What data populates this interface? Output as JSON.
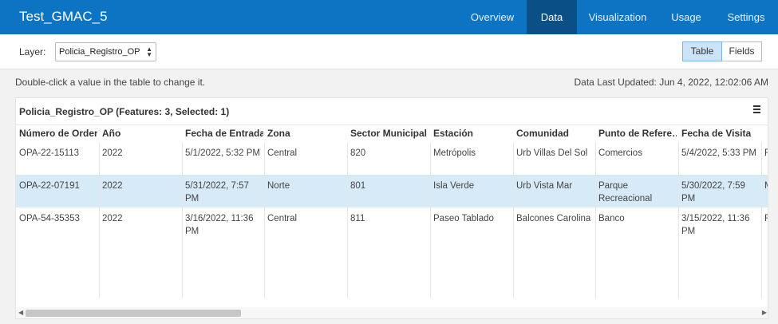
{
  "app": {
    "title": "Test_GMAC_5"
  },
  "nav": {
    "tabs": [
      "Overview",
      "Data",
      "Visualization",
      "Usage",
      "Settings"
    ],
    "active": "Data"
  },
  "layer": {
    "label": "Layer:",
    "selected": "Policia_Registro_OP"
  },
  "view_toggle": {
    "table": "Table",
    "fields": "Fields",
    "active": "Table"
  },
  "hint": "Double-click a value in the table to change it.",
  "last_updated": "Data Last Updated: Jun 4, 2022, 12:02:06 AM",
  "table": {
    "title": "Policia_Registro_OP (Features: 3, Selected: 1)",
    "columns": [
      "Número de Orden",
      "Año",
      "Fecha de Entrada",
      "Zona",
      "Sector Municipal",
      "Estación",
      "Comunidad",
      "Punto de Refere…",
      "Fecha de Visita"
    ],
    "rows": [
      [
        "OPA-22-15113",
        "2022",
        "5/1/2022, 5:32 PM",
        "Central",
        "820",
        "Metrópolis",
        "Urb Villas Del Sol",
        "Comercios",
        "5/4/2022, 5:33 PM",
        "F"
      ],
      [
        "OPA-22-07191",
        "2022",
        "5/31/2022, 7:57 PM",
        "Norte",
        "801",
        "Isla Verde",
        "Urb Vista Mar",
        "Parque Recreacional",
        "5/30/2022, 7:59 PM",
        "M"
      ],
      [
        "OPA-54-35353",
        "2022",
        "3/16/2022, 11:36 PM",
        "Central",
        "811",
        "Paseo Tablado",
        "Balcones Carolina",
        "Banco",
        "3/15/2022, 11:36 PM",
        "F"
      ]
    ],
    "selected_row": 1
  },
  "icons": {
    "menu": "hamburger-menu-icon",
    "select": "select-arrows-icon",
    "scroll_left": "triangle-left-icon",
    "scroll_right": "triangle-right-icon"
  },
  "colors": {
    "header_bg": "#0d74c4",
    "active_tab_bg": "#0a4f85",
    "selected_row_bg": "#d6eaf8",
    "toggle_active_bg": "#cce4f7"
  }
}
